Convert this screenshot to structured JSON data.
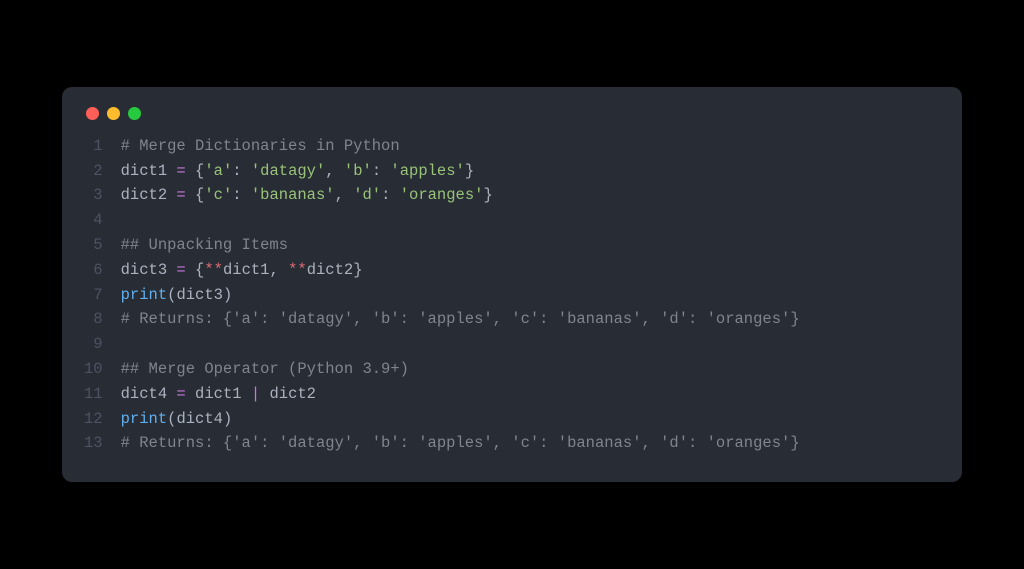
{
  "window": {
    "dots": [
      "red",
      "yellow",
      "green"
    ]
  },
  "code": {
    "lines": [
      {
        "num": "1",
        "tokens": [
          {
            "class": "tok-comment",
            "text": "# Merge Dictionaries in Python"
          }
        ]
      },
      {
        "num": "2",
        "tokens": [
          {
            "class": "tok-default",
            "text": "dict1 "
          },
          {
            "class": "tok-op",
            "text": "="
          },
          {
            "class": "tok-default",
            "text": " "
          },
          {
            "class": "tok-punc",
            "text": "{"
          },
          {
            "class": "tok-string",
            "text": "'a'"
          },
          {
            "class": "tok-punc",
            "text": ": "
          },
          {
            "class": "tok-string",
            "text": "'datagy'"
          },
          {
            "class": "tok-punc",
            "text": ", "
          },
          {
            "class": "tok-string",
            "text": "'b'"
          },
          {
            "class": "tok-punc",
            "text": ": "
          },
          {
            "class": "tok-string",
            "text": "'apples'"
          },
          {
            "class": "tok-punc",
            "text": "}"
          }
        ]
      },
      {
        "num": "3",
        "tokens": [
          {
            "class": "tok-default",
            "text": "dict2 "
          },
          {
            "class": "tok-op",
            "text": "="
          },
          {
            "class": "tok-default",
            "text": " "
          },
          {
            "class": "tok-punc",
            "text": "{"
          },
          {
            "class": "tok-string",
            "text": "'c'"
          },
          {
            "class": "tok-punc",
            "text": ": "
          },
          {
            "class": "tok-string",
            "text": "'bananas'"
          },
          {
            "class": "tok-punc",
            "text": ", "
          },
          {
            "class": "tok-string",
            "text": "'d'"
          },
          {
            "class": "tok-punc",
            "text": ": "
          },
          {
            "class": "tok-string",
            "text": "'oranges'"
          },
          {
            "class": "tok-punc",
            "text": "}"
          }
        ]
      },
      {
        "num": "4",
        "tokens": [
          {
            "class": "tok-default",
            "text": ""
          }
        ]
      },
      {
        "num": "5",
        "tokens": [
          {
            "class": "tok-comment",
            "text": "## Unpacking Items"
          }
        ]
      },
      {
        "num": "6",
        "tokens": [
          {
            "class": "tok-default",
            "text": "dict3 "
          },
          {
            "class": "tok-op",
            "text": "="
          },
          {
            "class": "tok-default",
            "text": " "
          },
          {
            "class": "tok-punc",
            "text": "{"
          },
          {
            "class": "tok-star",
            "text": "**"
          },
          {
            "class": "tok-default",
            "text": "dict1, "
          },
          {
            "class": "tok-star",
            "text": "**"
          },
          {
            "class": "tok-default",
            "text": "dict2"
          },
          {
            "class": "tok-punc",
            "text": "}"
          }
        ]
      },
      {
        "num": "7",
        "tokens": [
          {
            "class": "tok-func",
            "text": "print"
          },
          {
            "class": "tok-punc",
            "text": "("
          },
          {
            "class": "tok-default",
            "text": "dict3"
          },
          {
            "class": "tok-punc",
            "text": ")"
          }
        ]
      },
      {
        "num": "8",
        "tokens": [
          {
            "class": "tok-comment",
            "text": "# Returns: {'a': 'datagy', 'b': 'apples', 'c': 'bananas', 'd': 'oranges'}"
          }
        ]
      },
      {
        "num": "9",
        "tokens": [
          {
            "class": "tok-default",
            "text": ""
          }
        ]
      },
      {
        "num": "10",
        "tokens": [
          {
            "class": "tok-comment",
            "text": "## Merge Operator (Python 3.9+)"
          }
        ]
      },
      {
        "num": "11",
        "tokens": [
          {
            "class": "tok-default",
            "text": "dict4 "
          },
          {
            "class": "tok-op",
            "text": "="
          },
          {
            "class": "tok-default",
            "text": " dict1 "
          },
          {
            "class": "tok-op",
            "text": "|"
          },
          {
            "class": "tok-default",
            "text": " dict2"
          }
        ]
      },
      {
        "num": "12",
        "tokens": [
          {
            "class": "tok-func",
            "text": "print"
          },
          {
            "class": "tok-punc",
            "text": "("
          },
          {
            "class": "tok-default",
            "text": "dict4"
          },
          {
            "class": "tok-punc",
            "text": ")"
          }
        ]
      },
      {
        "num": "13",
        "tokens": [
          {
            "class": "tok-comment",
            "text": "# Returns: {'a': 'datagy', 'b': 'apples', 'c': 'bananas', 'd': 'oranges'}"
          }
        ]
      }
    ]
  }
}
